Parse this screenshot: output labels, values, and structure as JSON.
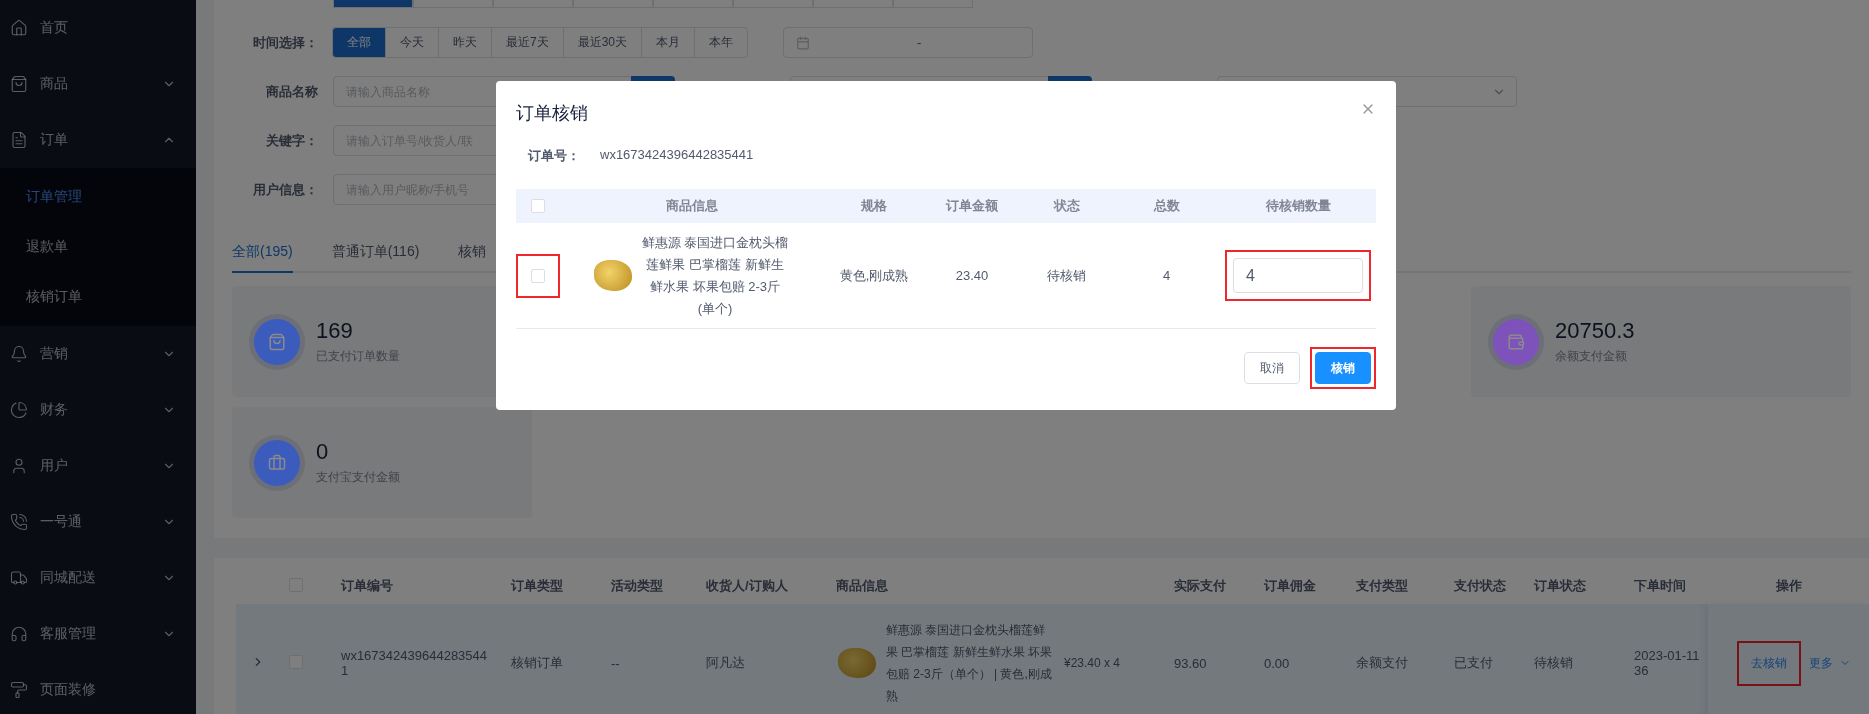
{
  "sidebar": {
    "items": [
      {
        "label": "首页"
      },
      {
        "label": "商品",
        "expanded": false
      },
      {
        "label": "订单",
        "expanded": true,
        "children": [
          {
            "label": "订单管理",
            "selected": true
          },
          {
            "label": "退款单",
            "selected": false
          },
          {
            "label": "核销订单",
            "selected": false
          }
        ]
      },
      {
        "label": "营销",
        "expanded": false
      },
      {
        "label": "财务",
        "expanded": false
      },
      {
        "label": "用户",
        "expanded": false
      },
      {
        "label": "一号通",
        "expanded": false
      },
      {
        "label": "同城配送",
        "expanded": false
      },
      {
        "label": "客服管理",
        "expanded": false
      },
      {
        "label": "页面装修"
      }
    ]
  },
  "filters": {
    "top_segments": [
      {
        "selected": true
      },
      {
        "selected": false
      },
      {
        "selected": false
      },
      {
        "selected": false
      },
      {
        "selected": false
      },
      {
        "selected": false
      },
      {
        "selected": false
      },
      {
        "selected": false
      }
    ],
    "time": {
      "label": "时间选择：",
      "options": [
        {
          "label": "全部",
          "selected": true
        },
        {
          "label": "今天",
          "selected": false
        },
        {
          "label": "昨天",
          "selected": false
        },
        {
          "label": "最近7天",
          "selected": false
        },
        {
          "label": "最近30天",
          "selected": false
        },
        {
          "label": "本月",
          "selected": false
        },
        {
          "label": "本年",
          "selected": false
        }
      ],
      "date_separator": "-"
    },
    "product_name": {
      "label": "商品名称",
      "placeholder": "请输入商品名称"
    },
    "keyword": {
      "label": "关键字：",
      "placeholder": "请输入订单号/收货人/联"
    },
    "user_info": {
      "label": "用户信息：",
      "placeholder": "请输入用户昵称/手机号"
    }
  },
  "order_tabs": [
    {
      "label": "全部(195)",
      "selected": true
    },
    {
      "label": "普通订单(116)",
      "selected": false
    },
    {
      "label": "核销",
      "selected": false
    }
  ],
  "stats": [
    [
      {
        "value": "169",
        "label": "已支付订单数量",
        "color": "#3b5bbd"
      },
      {
        "value": "20750.3",
        "label": "余额支付金额",
        "color": "#7e52bb"
      }
    ],
    [
      {
        "value": "0",
        "label": "支付宝支付金额",
        "color": "#3b5bbd"
      }
    ]
  ],
  "orders": {
    "header_checked": false,
    "columns": [
      "订单编号",
      "订单类型",
      "活动类型",
      "收货人/订购人",
      "商品信息",
      "实际支付",
      "订单佣金",
      "支付类型",
      "支付状态",
      "订单状态",
      "下单时间",
      "操作"
    ],
    "rows": [
      {
        "expanded": false,
        "checked": false,
        "order_no": "wx1673424396442835441",
        "type": "核销订单",
        "activity": "--",
        "receiver": "阿凡达",
        "product": "鲜惠源 泰国进口金枕头榴莲鲜果 巴掌榴莲 新鲜生鲜水果 坏果包赔 2-3斤（单个） | 黄色,刚成熟",
        "price": "¥23.40 x 4",
        "paid": "93.60",
        "commission": "0.00",
        "pay_type": "余额支付",
        "pay_status": "已支付",
        "order_status": "待核销",
        "time": "2023-01-11\n36",
        "actions": [
          {
            "label": "去核销",
            "kind": "link",
            "highlighted": true
          },
          {
            "label": "更多",
            "kind": "dropdown",
            "highlighted": false
          }
        ]
      }
    ]
  },
  "dialog": {
    "title": "订单核销",
    "order_no_label": "订单号：",
    "order_no": "wx1673424396442835441",
    "header_checked": false,
    "columns": [
      "商品信息",
      "规格",
      "订单金额",
      "状态",
      "总数",
      "待核销数量"
    ],
    "rows": [
      {
        "checked": false,
        "highlighted": true,
        "product": "鲜惠源 泰国进口金枕头榴莲鲜果 巴掌榴莲 新鲜生鲜水果 坏果包赔 2-3斤 (单个)",
        "spec": "黄色,刚成熟",
        "amount": "23.40",
        "status": "待核销",
        "total": "4",
        "quantity": "4",
        "quantity_highlighted": true
      }
    ],
    "buttons": [
      {
        "label": "取消",
        "kind": "secondary",
        "highlighted": false
      },
      {
        "label": "核销",
        "kind": "primary",
        "highlighted": true
      }
    ]
  }
}
